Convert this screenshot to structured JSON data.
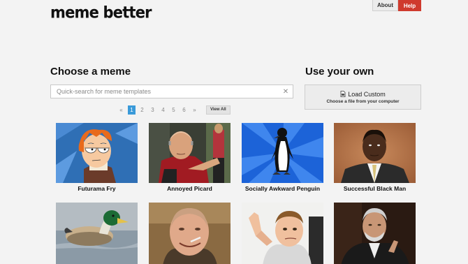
{
  "header": {
    "logo": "meme better",
    "nav": {
      "about": "About",
      "help": "Help"
    }
  },
  "choose": {
    "title": "Choose a meme",
    "search_placeholder": "Quick-search for meme templates",
    "clear_icon": "close-icon"
  },
  "own": {
    "title": "Use your own",
    "load_label": "Load Custom",
    "load_sub": "Choose a file from your computer",
    "load_icon": "file-icon"
  },
  "pagination": {
    "prev": "«",
    "pages": [
      "1",
      "2",
      "3",
      "4",
      "5",
      "6"
    ],
    "current": "1",
    "next": "»",
    "view_all": "View All"
  },
  "memes": [
    {
      "name": "Futurama Fry"
    },
    {
      "name": "Annoyed Picard"
    },
    {
      "name": "Socially Awkward Penguin"
    },
    {
      "name": "Successful Black Man"
    },
    {
      "name": ""
    },
    {
      "name": ""
    },
    {
      "name": ""
    },
    {
      "name": ""
    }
  ],
  "colors": {
    "accent_red": "#cf3a2d",
    "pager_active": "#3a9ad9",
    "background": "#f3f3f3"
  }
}
